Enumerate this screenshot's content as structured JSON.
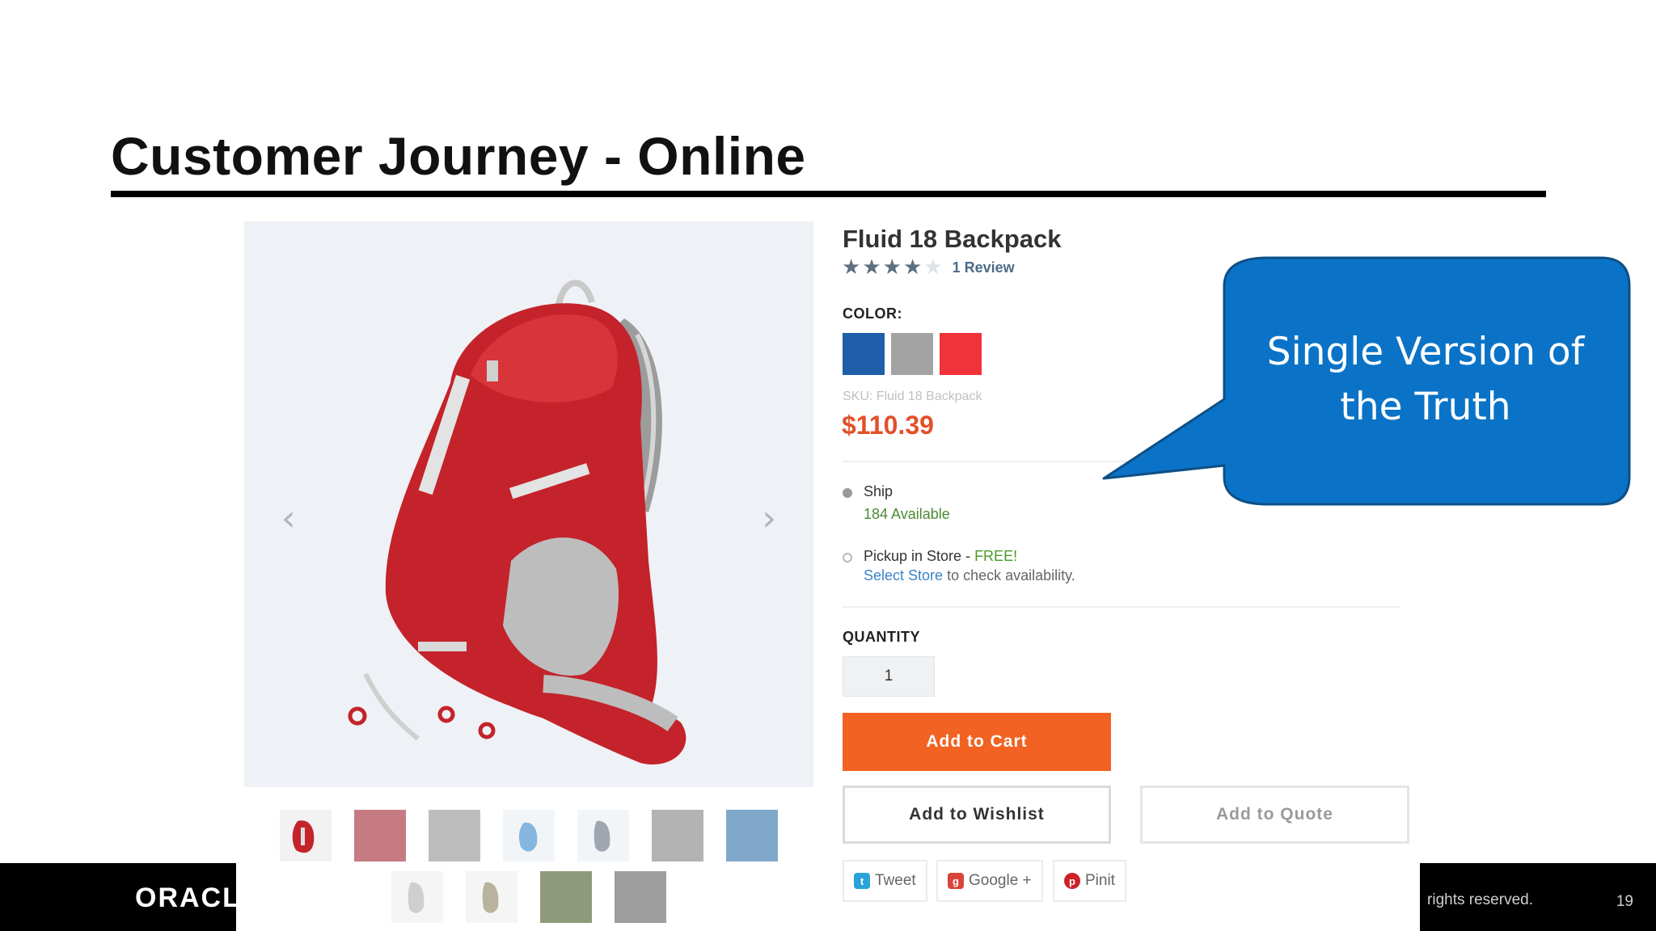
{
  "slide": {
    "title": "Customer Journey - Online",
    "footer_logo": "ORACLE",
    "footer_copyright": "rights reserved.",
    "page_number": "19"
  },
  "product": {
    "name": "Fluid 18 Backpack",
    "rating": {
      "stars": 4,
      "max": 5,
      "review_text": "1 Review"
    },
    "color_label": "COLOR:",
    "swatches": [
      {
        "name": "blue",
        "color": "#1f5ea8"
      },
      {
        "name": "gray",
        "color": "#a3a3a3"
      },
      {
        "name": "red",
        "color": "#f0333a"
      }
    ],
    "sku": "SKU: Fluid 18 Backpack",
    "price": "$110.39",
    "fulfillment": {
      "ship_label": "Ship",
      "ship_availability": "184 Available",
      "pickup_label": "Pickup in Store - ",
      "pickup_free": "FREE!",
      "select_store_link": "Select Store",
      "select_store_suffix": " to check availability."
    },
    "quantity_label": "QUANTITY",
    "quantity_value": "1",
    "buttons": {
      "add_to_cart": "Add to Cart",
      "add_to_wishlist": "Add to Wishlist",
      "add_to_quote": "Add to Quote"
    },
    "share": {
      "tweet": "Tweet",
      "google": "Google +",
      "pinit": "Pinit"
    },
    "gallery": {
      "prev_icon": "chevron-left-icon",
      "next_icon": "chevron-right-icon",
      "thumbnail_count": 11
    }
  },
  "callout": {
    "text_line1": "Single Version of",
    "text_line2": "the Truth",
    "fill": "#0a73c7",
    "stroke": "#0e4f86"
  },
  "colors": {
    "accent_orange": "#f26222",
    "price_red": "#e2502a",
    "available_green": "#4c8a33"
  }
}
